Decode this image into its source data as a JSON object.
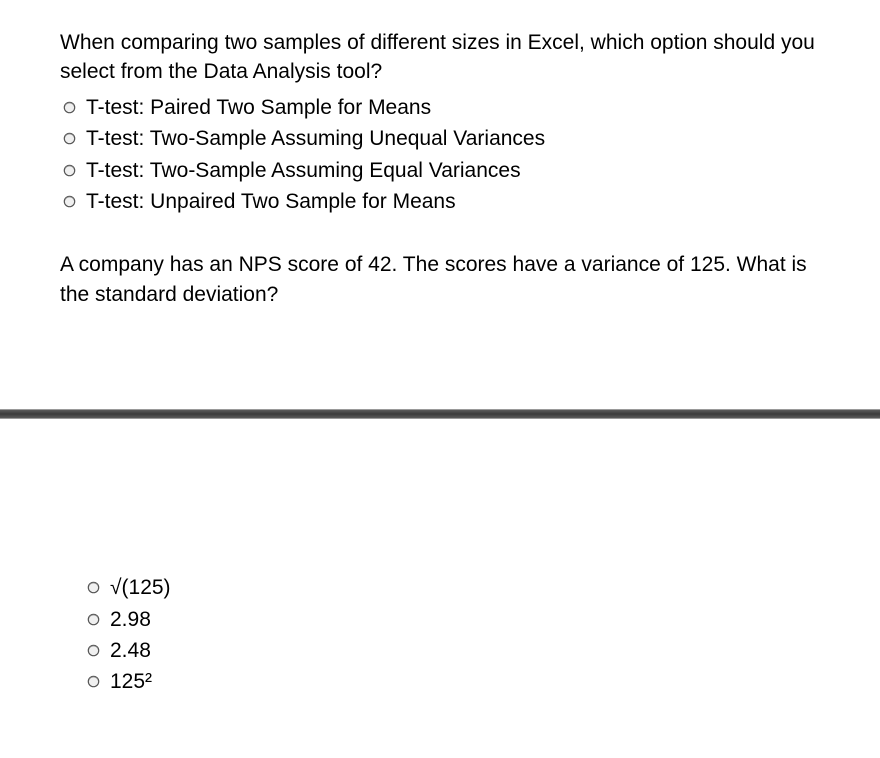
{
  "question1": {
    "text": "When comparing two samples of different sizes in Excel, which option should you select from the Data Analysis tool?",
    "options": [
      "T-test: Paired Two Sample for Means",
      "T-test: Two-Sample Assuming Unequal Variances",
      "T-test: Two-Sample Assuming Equal Variances",
      "T-test: Unpaired Two Sample for Means"
    ]
  },
  "question2": {
    "text": "A company has an NPS score of 42. The scores have a variance of 125. What is the standard deviation?",
    "options": [
      "√(125)",
      "2.98",
      "2.48",
      "125²"
    ]
  }
}
